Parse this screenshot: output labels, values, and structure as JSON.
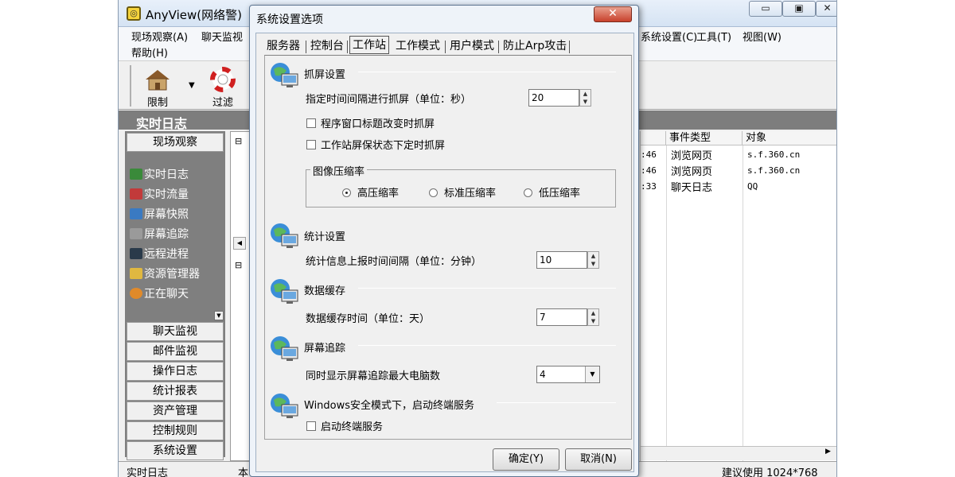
{
  "main": {
    "title": "AnyView(网络警)",
    "menus": [
      "现场观察(A)",
      "聊天监视",
      "系统设置(C)",
      "工具(T)",
      "视图(W)",
      "帮助(H)"
    ],
    "toolbar": {
      "restrict": "限制",
      "filter": "过滤"
    },
    "section_title": "实时日志",
    "sidebar": {
      "head": "现场观察",
      "items": [
        "实时日志",
        "实时流量",
        "屏幕快照",
        "屏幕追踪",
        "远程进程",
        "资源管理器",
        "正在聊天"
      ],
      "buttons": [
        "聊天监视",
        "邮件监视",
        "操作日志",
        "统计报表",
        "资产管理",
        "控制规则",
        "系统设置"
      ]
    },
    "grid": {
      "headers": [
        "事件类型",
        "对象"
      ],
      "rows": [
        {
          "time": ":46",
          "type": "浏览网页",
          "obj": "s.f.360.cn"
        },
        {
          "time": ":46",
          "type": "浏览网页",
          "obj": "s.f.360.cn"
        },
        {
          "time": ":33",
          "type": "聊天日志",
          "obj": "QQ"
        }
      ]
    },
    "status": {
      "left": "实时日志",
      "mid": "本",
      "right": "建议使用 1024*768"
    }
  },
  "dialog": {
    "title": "系统设置选项",
    "close": "✕",
    "tabs": [
      "服务器",
      "控制台",
      "工作站",
      "工作模式",
      "用户模式",
      "防止Arp攻击"
    ],
    "active_tab": 2,
    "capture": {
      "title": "抓屏设置",
      "interval_label": "指定时间间隔进行抓屏（单位：秒）",
      "interval_value": "20",
      "cb1": "程序窗口标题改变时抓屏",
      "cb2": "工作站屏保状态下定时抓屏",
      "compress_group": "图像压缩率",
      "radios": [
        "高压缩率",
        "标准压缩率",
        "低压缩率"
      ],
      "radio_selected": 0
    },
    "stats": {
      "title": "统计设置",
      "label": "统计信息上报时间间隔（单位：分钟）",
      "value": "10"
    },
    "cache": {
      "title": "数据缓存",
      "label": "数据缓存时间（单位：天）",
      "value": "7"
    },
    "tracking": {
      "title": "屏幕追踪",
      "label": "同时显示屏幕追踪最大电脑数",
      "value": "4"
    },
    "safe": {
      "title": "Windows安全模式下，启动终端服务",
      "cb": "启动终端服务"
    },
    "ok": "确定(Y)",
    "cancel": "取消(N)"
  },
  "colors": {
    "dark_panel": "#7f7f7f",
    "title_bar": "#d5e3f3",
    "close_red": "#c8412c"
  }
}
